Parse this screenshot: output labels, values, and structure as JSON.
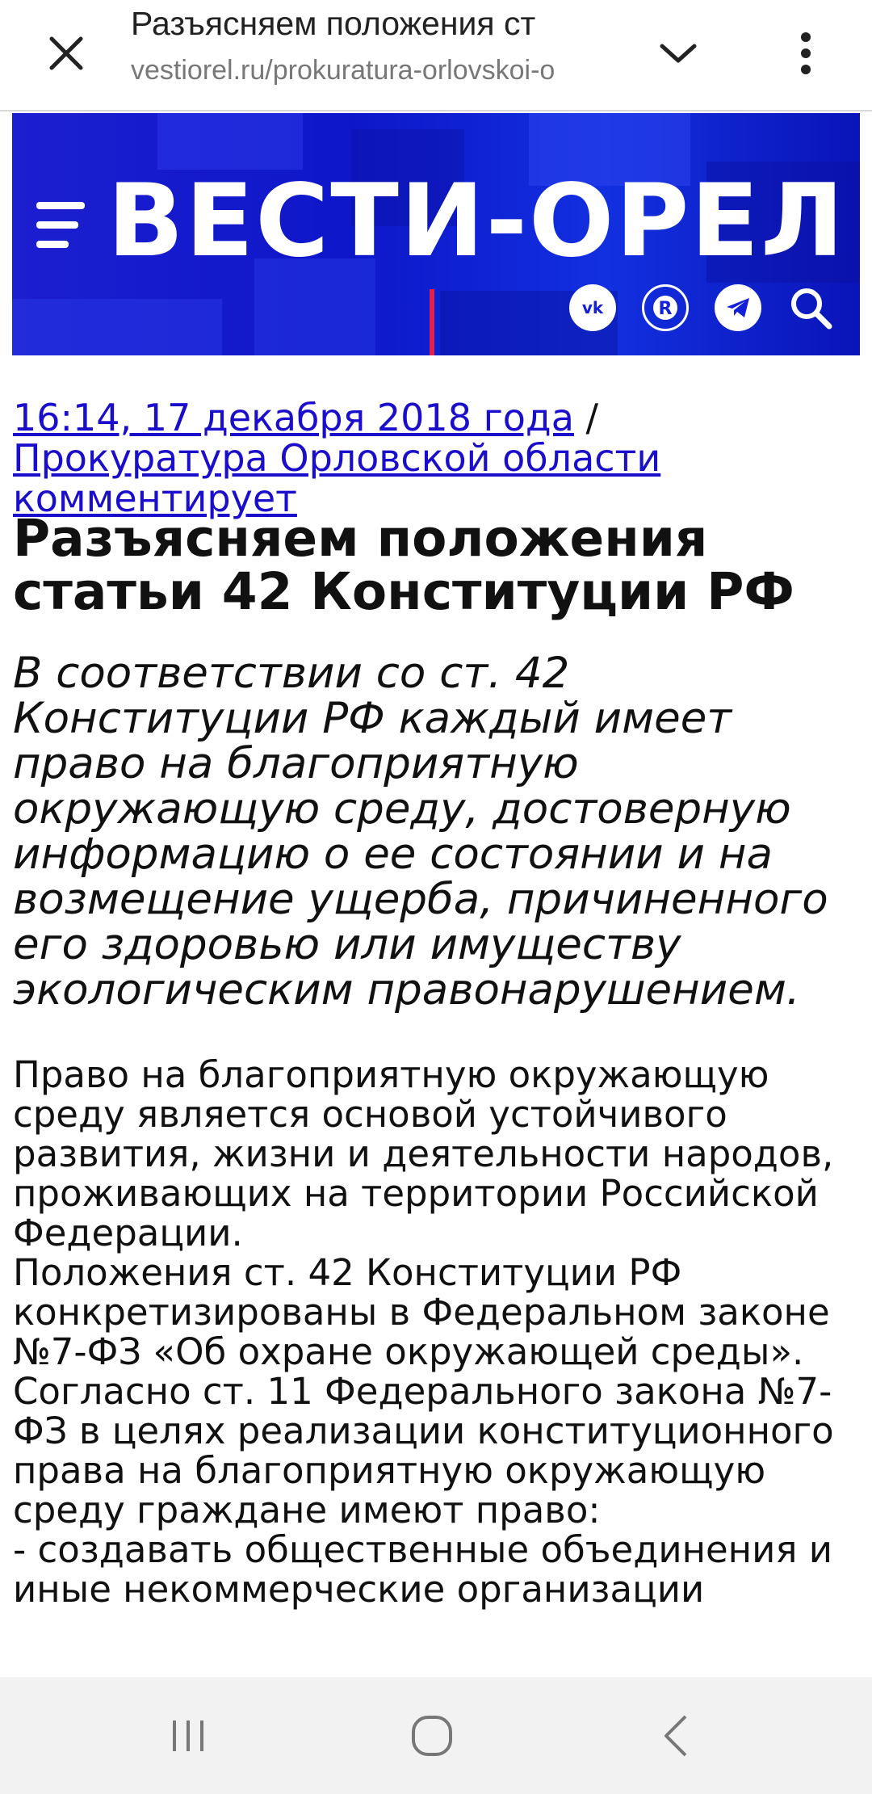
{
  "browser": {
    "title": "Разъясняем положения ст",
    "url": "vestiorel.ru/prokuratura-orlovskoi-o",
    "icons": {
      "close": "close-icon",
      "expand": "chevron-down-icon",
      "more": "more-vertical-icon"
    }
  },
  "site": {
    "logo_text": "ВЕСТИ-ОРЕЛ",
    "brand_color": "#1420d8",
    "accent_red": "#e0224a",
    "social_icons": [
      "vk-icon",
      "rutube-icon",
      "telegram-icon",
      "search-icon"
    ]
  },
  "article": {
    "date_link": "16:14, 17 декабря 2018 года",
    "separator": " / ",
    "category_link": "Прокуратура Орловской области комментирует",
    "headline": "Разъясняем положения статьи 42 Конституции РФ",
    "lead": "В соответствии со ст. 42 Конституции РФ каждый имеет право на благоприятную окружающую среду, достоверную информацию о ее состоянии и на возмещение ущерба, причиненного его здоровью или имуществу экологическим правонарушением.",
    "paragraphs": [
      "Право на благоприятную окружающую среду является основой устойчивого развития, жизни и деятельности народов, проживающих на территории Российской Федерации.",
      "Положения ст. 42 Конституции РФ конкретизированы в Федеральном законе №7-ФЗ «Об охране окружающей среды».",
      "Согласно ст. 11 Федерального закона №7-ФЗ в целях реализации конституционного права на благоприятную окружающую среду граждане имеют право:",
      "- создавать общественные объединения и иные некоммерческие организации"
    ]
  },
  "system_nav": {
    "icons": [
      "recent-apps-icon",
      "home-icon",
      "back-icon"
    ]
  }
}
